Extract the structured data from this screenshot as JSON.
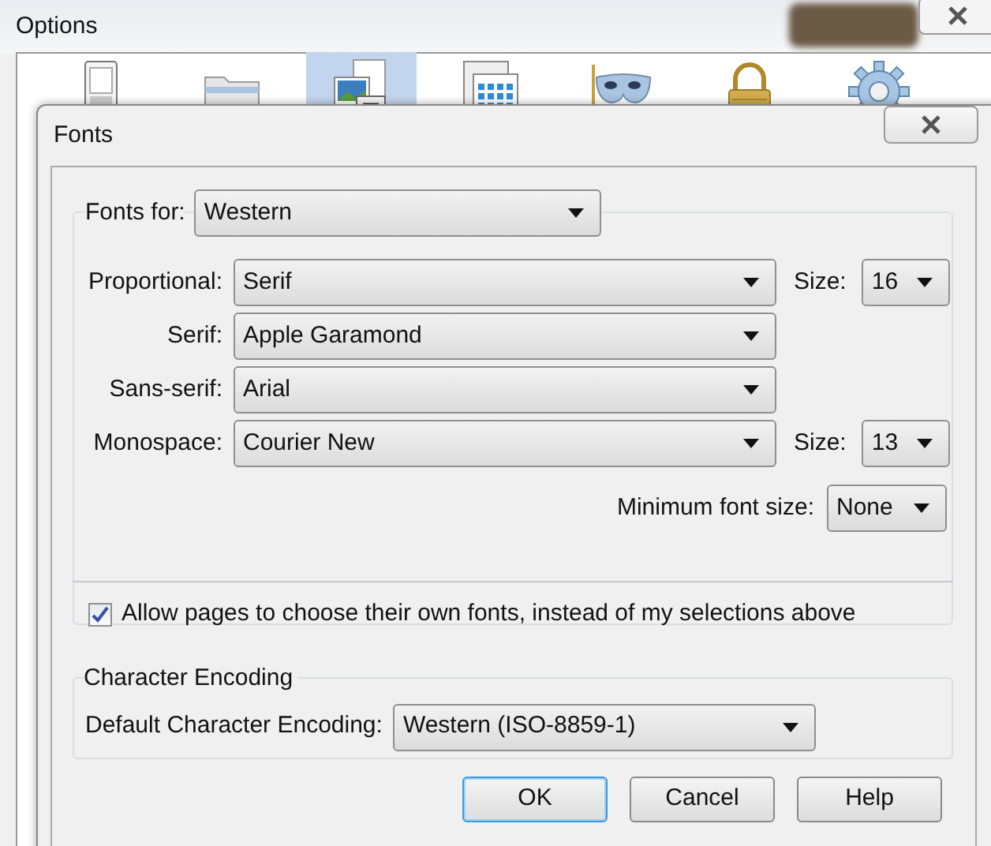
{
  "window": {
    "title": "Options",
    "toolbar": [
      {
        "kind": "switch",
        "selected": false
      },
      {
        "kind": "folder",
        "selected": false
      },
      {
        "kind": "content",
        "selected": true
      },
      {
        "kind": "calendar",
        "selected": false
      },
      {
        "kind": "mask",
        "selected": false
      },
      {
        "kind": "lock",
        "selected": false
      },
      {
        "kind": "gear",
        "selected": false
      }
    ]
  },
  "dialog": {
    "title": "Fonts",
    "fonts_for": {
      "label": "Fonts for:",
      "value": "Western"
    },
    "rows": [
      {
        "label": "Proportional:",
        "value": "Serif",
        "size_label": "Size:",
        "size": "16"
      },
      {
        "label": "Serif:",
        "value": "Apple Garamond"
      },
      {
        "label": "Sans-serif:",
        "value": "Arial"
      },
      {
        "label": "Monospace:",
        "value": "Courier New",
        "size_label": "Size:",
        "size": "13"
      }
    ],
    "minimum": {
      "label": "Minimum font size:",
      "value": "None"
    },
    "allow": {
      "label": "Allow pages to choose their own fonts, instead of my selections above",
      "checked": true
    },
    "encoding": {
      "title": "Character Encoding",
      "label": "Default Character Encoding:",
      "value": "Western (ISO-8859-1)"
    },
    "buttons": [
      {
        "label": "OK",
        "default": true
      },
      {
        "label": "Cancel",
        "default": false
      },
      {
        "label": "Help",
        "default": false
      }
    ]
  }
}
